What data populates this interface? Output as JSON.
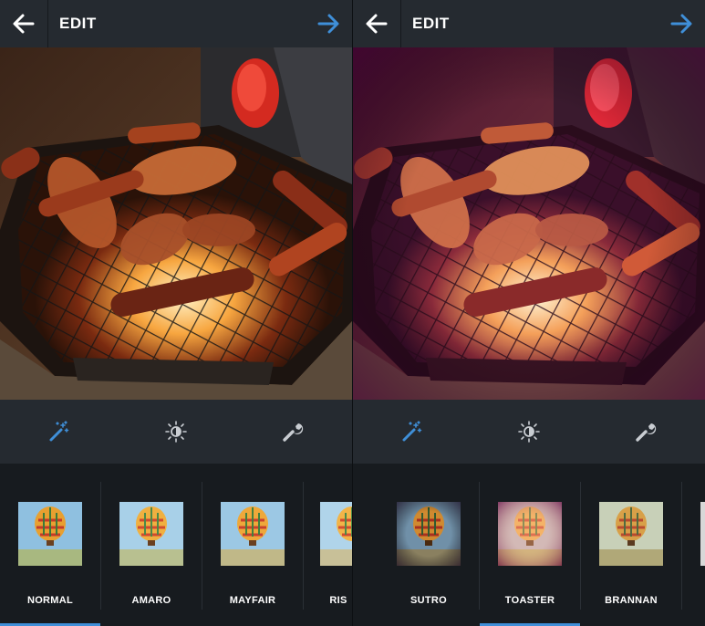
{
  "screens": [
    {
      "title": "EDIT",
      "filters": [
        {
          "label": "NORMAL"
        },
        {
          "label": "AMARO"
        },
        {
          "label": "MAYFAIR"
        },
        {
          "label": "RIS"
        }
      ]
    },
    {
      "title": "EDIT",
      "filters": [
        {
          "label": "SUTRO"
        },
        {
          "label": "TOASTER"
        },
        {
          "label": "BRANNAN"
        },
        {
          "label": ""
        }
      ]
    }
  ],
  "icons": {
    "back": "back-arrow-icon",
    "next": "next-arrow-icon",
    "filter_tool": "magic-wand-icon",
    "lux_tool": "brightness-icon",
    "settings_tool": "wrench-icon"
  },
  "colors": {
    "topbar": "#252a30",
    "accent": "#3f8fd8",
    "strip": "#171b1f"
  }
}
